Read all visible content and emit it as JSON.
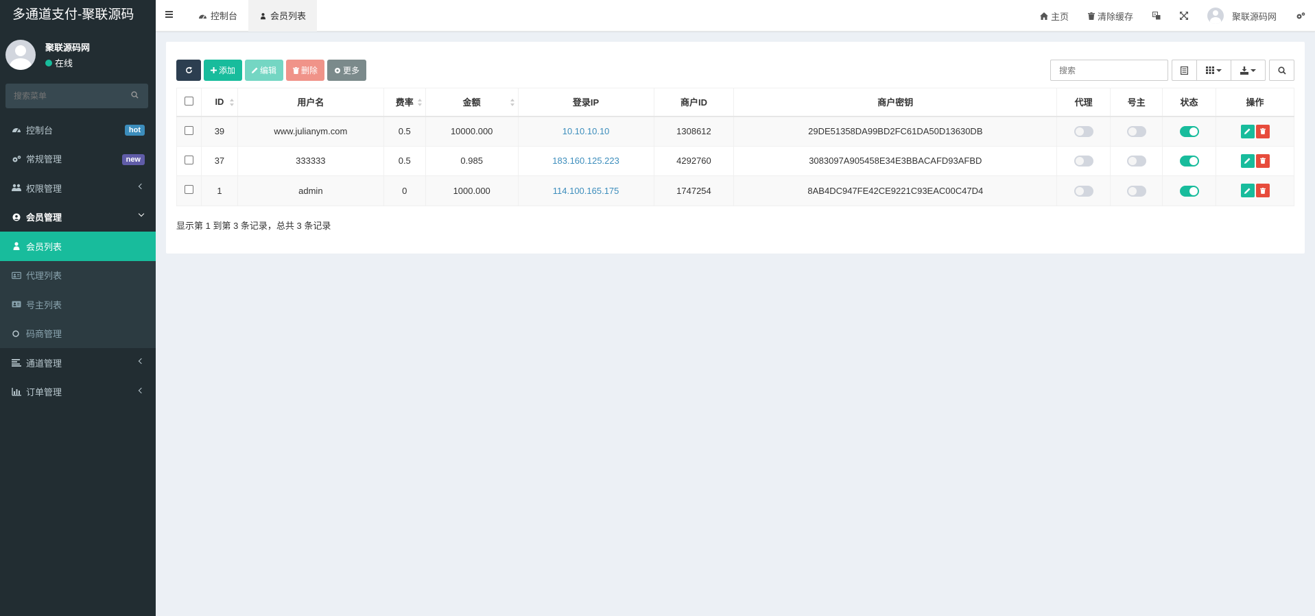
{
  "app": {
    "title": "多通道支付-聚联源码"
  },
  "user": {
    "name": "聚联源码网",
    "status": "在线"
  },
  "sidebar": {
    "search_placeholder": "搜索菜单",
    "items": [
      {
        "label": "控制台",
        "badge": "hot"
      },
      {
        "label": "常规管理",
        "badge": "new"
      },
      {
        "label": "权限管理"
      },
      {
        "label": "会员管理"
      },
      {
        "label": "会员列表"
      },
      {
        "label": "代理列表"
      },
      {
        "label": "号主列表"
      },
      {
        "label": "码商管理"
      },
      {
        "label": "通道管理"
      },
      {
        "label": "订单管理"
      }
    ]
  },
  "header": {
    "tabs": [
      {
        "label": "控制台"
      },
      {
        "label": "会员列表"
      }
    ],
    "home": "主页",
    "clear_cache": "清除缓存",
    "username": "聚联源码网"
  },
  "toolbar": {
    "add": "添加",
    "edit": "编辑",
    "delete": "删除",
    "more": "更多",
    "search_placeholder": "搜索"
  },
  "table": {
    "headers": {
      "id": "ID",
      "username": "用户名",
      "rate": "费率",
      "amount": "金额",
      "login_ip": "登录IP",
      "merchant_id": "商户ID",
      "merchant_key": "商户密钥",
      "agent": "代理",
      "owner": "号主",
      "status": "状态",
      "actions": "操作"
    },
    "rows": [
      {
        "id": "39",
        "username": "www.julianym.com",
        "rate": "0.5",
        "amount": "10000.000",
        "login_ip": "10.10.10.10",
        "merchant_id": "1308612",
        "merchant_key": "29DE51358DA99BD2FC61DA50D13630DB",
        "agent": false,
        "owner": false,
        "status": true
      },
      {
        "id": "37",
        "username": "333333",
        "rate": "0.5",
        "amount": "0.985",
        "login_ip": "183.160.125.223",
        "merchant_id": "4292760",
        "merchant_key": "3083097A905458E34E3BBACAFD93AFBD",
        "agent": false,
        "owner": false,
        "status": true
      },
      {
        "id": "1",
        "username": "admin",
        "rate": "0",
        "amount": "1000.000",
        "login_ip": "114.100.165.175",
        "merchant_id": "1747254",
        "merchant_key": "8AB4DC947FE42CE9221C93EAC00C47D4",
        "agent": false,
        "owner": false,
        "status": true
      }
    ]
  },
  "pagination": {
    "info": "显示第 1 到第 3 条记录，总共 3 条记录"
  },
  "colors": {
    "sidebar_bg": "#222d32",
    "accent": "#18bc9c",
    "danger": "#e74c3c",
    "dark": "#2c3e50",
    "link": "#3c8dbc"
  }
}
